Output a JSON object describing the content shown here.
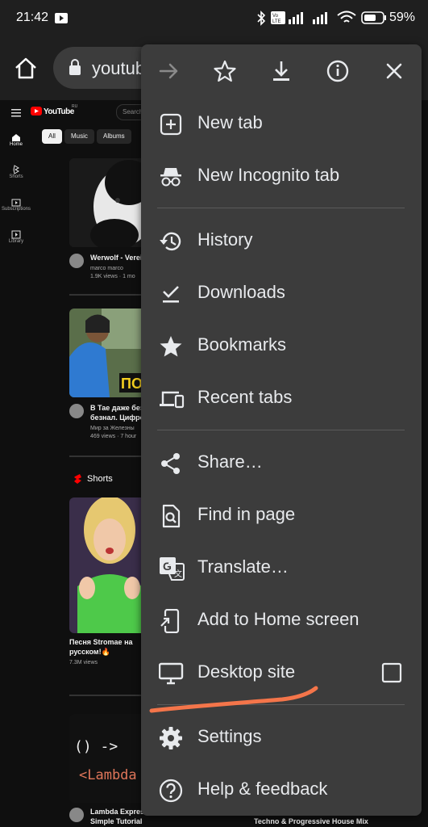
{
  "status_bar": {
    "time": "21:42",
    "battery": "59%"
  },
  "toolbar": {
    "url": "youtub"
  },
  "youtube": {
    "logo": "YouTube",
    "logo_region": "RU",
    "search_placeholder": "Search",
    "sidebar": [
      {
        "label": "Home",
        "icon": "home-icon"
      },
      {
        "label": "Shorts",
        "icon": "shorts-icon"
      },
      {
        "label": "Subscriptions",
        "icon": "subscriptions-icon"
      },
      {
        "label": "Library",
        "icon": "library-icon"
      }
    ],
    "chips": [
      "All",
      "Music",
      "Albums"
    ],
    "videos": [
      {
        "title": "Werwolf - Vereir",
        "channel": "marco marco",
        "meta": "1.9K views · 1 mo"
      },
      {
        "title": "В Тае даже безд",
        "title2": "безнал. Цифров",
        "overlay": "ПО",
        "channel": "Мир за Железны",
        "meta": "469 views · 7 hour"
      }
    ],
    "shorts_heading": "Shorts",
    "short": {
      "title": "Песня Stromae на",
      "title2": "русском!🔥",
      "meta": "7.3M views"
    },
    "code_thumb": {
      "line1": "() ->",
      "line2": "<Lambda"
    },
    "bottom_titles": {
      "left": "Lambda Expressi",
      "left2": "Simple Tutorial",
      "right": "Techno & Progressive House Mix"
    }
  },
  "menu": {
    "top_icons": [
      "forward-icon",
      "bookmark-star-icon",
      "download-icon",
      "info-icon",
      "close-icon"
    ],
    "items": [
      {
        "label": "New tab",
        "icon": "new-tab-icon"
      },
      {
        "label": "New Incognito tab",
        "icon": "incognito-icon"
      },
      {
        "label": "History",
        "icon": "history-icon"
      },
      {
        "label": "Downloads",
        "icon": "downloads-icon"
      },
      {
        "label": "Bookmarks",
        "icon": "star-icon"
      },
      {
        "label": "Recent tabs",
        "icon": "devices-icon"
      },
      {
        "label": "Share…",
        "icon": "share-icon"
      },
      {
        "label": "Find in page",
        "icon": "find-in-page-icon"
      },
      {
        "label": "Translate…",
        "icon": "translate-icon"
      },
      {
        "label": "Add to Home screen",
        "icon": "add-to-home-icon"
      },
      {
        "label": "Desktop site",
        "icon": "desktop-icon",
        "checked": false
      },
      {
        "label": "Settings",
        "icon": "settings-icon"
      },
      {
        "label": "Help & feedback",
        "icon": "help-icon"
      }
    ]
  },
  "annotation": {
    "color": "#f4754a"
  }
}
